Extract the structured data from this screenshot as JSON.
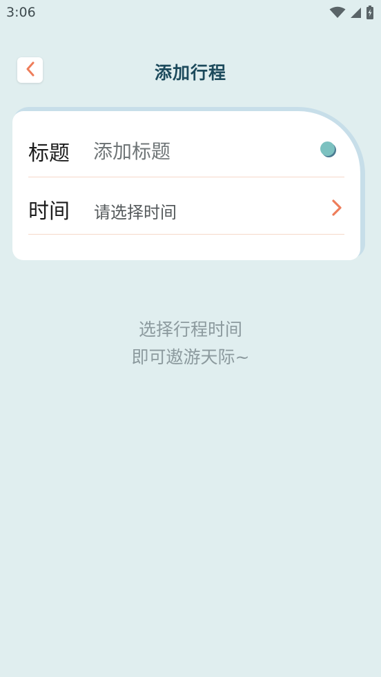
{
  "status_bar": {
    "time": "3:06",
    "icons": [
      "wifi-icon",
      "signal-icon",
      "battery-icon"
    ]
  },
  "header": {
    "back_icon": "chevron-left-icon",
    "title": "添加行程"
  },
  "form": {
    "title_row": {
      "label": "标题",
      "placeholder": "添加标题",
      "value": ""
    },
    "time_row": {
      "label": "时间",
      "value": "请选择时间",
      "icon": "chevron-right-icon"
    }
  },
  "hint": {
    "line1": "选择行程时间",
    "line2": "即可遨游天际~"
  },
  "colors": {
    "background": "#e0eeef",
    "accent": "#ee7d5a",
    "title": "#1c4a5c",
    "divider": "#f6d8c9",
    "card_back": "#c7dee9"
  }
}
